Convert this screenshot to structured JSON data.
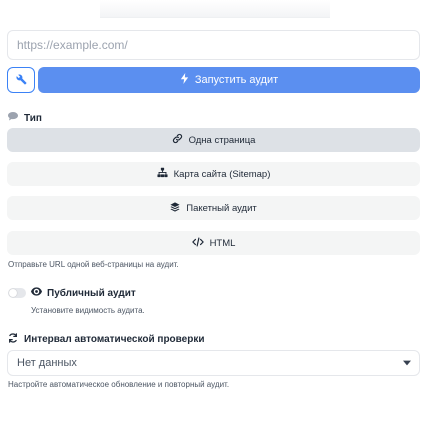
{
  "url_input": {
    "placeholder": "https://example.com/",
    "value": ""
  },
  "run_button": {
    "label": "Запустить аудит"
  },
  "type_section": {
    "label": "Тип",
    "options": [
      {
        "label": "Одна страница",
        "icon": "link-icon",
        "selected": true
      },
      {
        "label": "Карта сайта (Sitemap)",
        "icon": "sitemap-icon",
        "selected": false
      },
      {
        "label": "Пакетный аудит",
        "icon": "layers-icon",
        "selected": false
      },
      {
        "label": "HTML",
        "icon": "code-icon",
        "selected": false
      }
    ],
    "hint": "Отправьте URL одной веб-страницы на аудит."
  },
  "public_audit": {
    "label": "Публичный аудит",
    "enabled": false,
    "hint": "Установите видимость аудита."
  },
  "interval": {
    "label": "Интервал автоматической проверки",
    "selected": "Нет данных",
    "hint": "Настройте автоматическое обновление и повторный аудит."
  },
  "colors": {
    "primary": "#5b8ff0",
    "primary_border": "#3b82f6",
    "option_bg": "#f4f5f5",
    "option_active_bg": "#dde1e6"
  }
}
